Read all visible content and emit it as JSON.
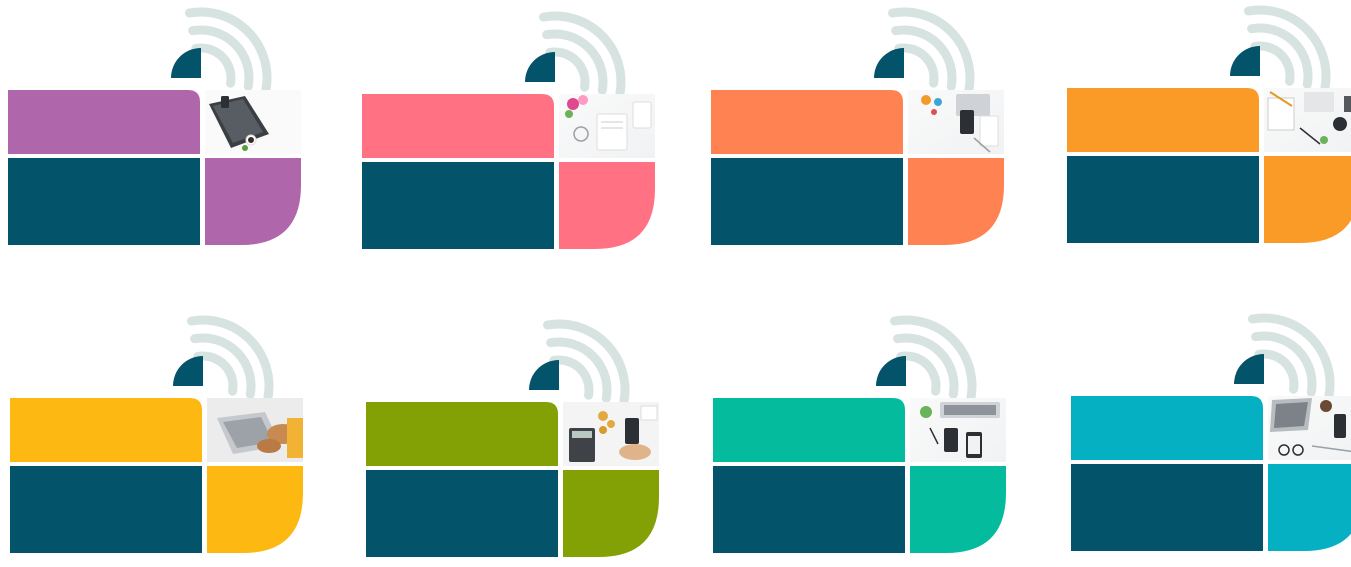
{
  "accent_colors": {
    "navy": "#03536a",
    "wifi_signal": "#d6e3e1"
  },
  "variants": [
    {
      "name": "purple",
      "accent": "#b066ab",
      "photo": "laptop-phone-desk"
    },
    {
      "name": "pink",
      "accent": "#ff7183",
      "photo": "notebook-flowers-desk"
    },
    {
      "name": "coral",
      "accent": "#ff8252",
      "photo": "phone-clipboard-desk"
    },
    {
      "name": "orange",
      "accent": "#fa9a27",
      "photo": "notepad-pen-desk"
    },
    {
      "name": "yellow",
      "accent": "#fdb811",
      "photo": "hands-typing-laptop"
    },
    {
      "name": "olive",
      "accent": "#83a004",
      "photo": "calculator-phone-coins"
    },
    {
      "name": "teal",
      "accent": "#04bc9d",
      "photo": "keyboard-phones-desk"
    },
    {
      "name": "cyan",
      "accent": "#04b0c2",
      "photo": "laptop-glasses-desk"
    }
  ]
}
